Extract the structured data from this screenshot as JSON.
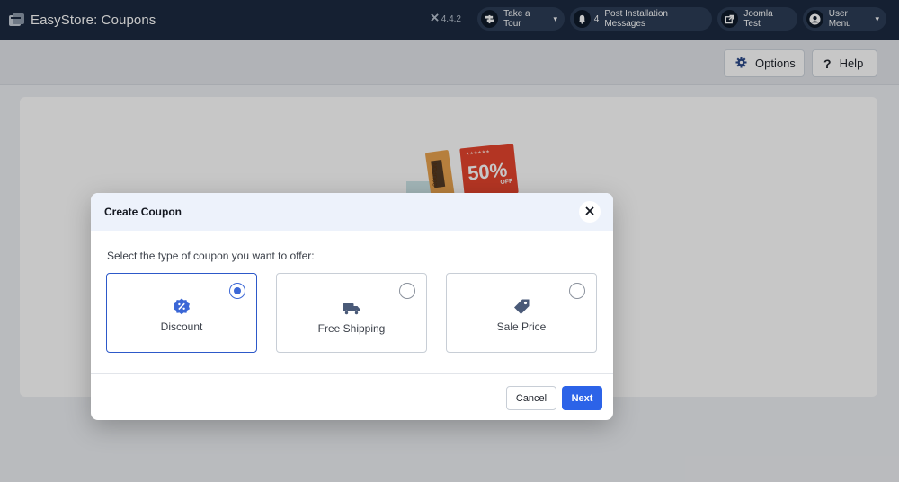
{
  "header": {
    "title": "EasyStore: Coupons",
    "version": "4.4.2",
    "take_tour": "Take a Tour",
    "notifications_count": "4",
    "post_install": "Post Installation Messages",
    "site_name": "Joomla Test",
    "user_menu": "User Menu"
  },
  "toolbar": {
    "options_label": "Options",
    "help_label": "Help"
  },
  "illustration": {
    "coupon_text": "COUPON",
    "discount_text": "50%",
    "off_text": "OFF"
  },
  "modal": {
    "title": "Create Coupon",
    "prompt": "Select the type of coupon you want to offer:",
    "options": [
      {
        "label": "Discount",
        "selected": true,
        "icon": "discount-badge-icon"
      },
      {
        "label": "Free Shipping",
        "selected": false,
        "icon": "truck-icon"
      },
      {
        "label": "Sale Price",
        "selected": false,
        "icon": "tag-icon"
      }
    ],
    "cancel_label": "Cancel",
    "next_label": "Next"
  },
  "colors": {
    "header_bg": "#1c2a40",
    "accent": "#2c63e8",
    "selected_border": "#2d59c9",
    "icon_color": "#3b67d6"
  }
}
